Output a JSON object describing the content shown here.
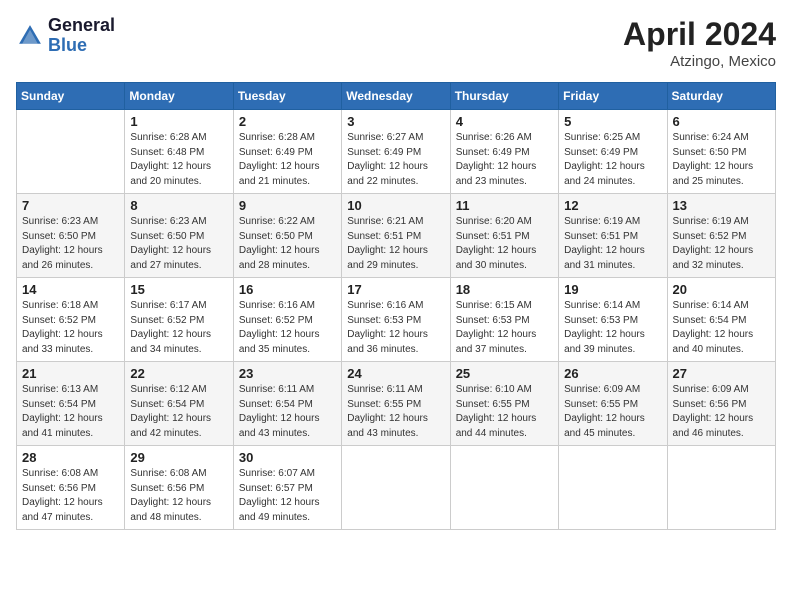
{
  "header": {
    "logo_line1": "General",
    "logo_line2": "Blue",
    "month": "April 2024",
    "location": "Atzingo, Mexico"
  },
  "weekdays": [
    "Sunday",
    "Monday",
    "Tuesday",
    "Wednesday",
    "Thursday",
    "Friday",
    "Saturday"
  ],
  "weeks": [
    [
      {
        "day": "",
        "info": ""
      },
      {
        "day": "1",
        "info": "Sunrise: 6:28 AM\nSunset: 6:48 PM\nDaylight: 12 hours\nand 20 minutes."
      },
      {
        "day": "2",
        "info": "Sunrise: 6:28 AM\nSunset: 6:49 PM\nDaylight: 12 hours\nand 21 minutes."
      },
      {
        "day": "3",
        "info": "Sunrise: 6:27 AM\nSunset: 6:49 PM\nDaylight: 12 hours\nand 22 minutes."
      },
      {
        "day": "4",
        "info": "Sunrise: 6:26 AM\nSunset: 6:49 PM\nDaylight: 12 hours\nand 23 minutes."
      },
      {
        "day": "5",
        "info": "Sunrise: 6:25 AM\nSunset: 6:49 PM\nDaylight: 12 hours\nand 24 minutes."
      },
      {
        "day": "6",
        "info": "Sunrise: 6:24 AM\nSunset: 6:50 PM\nDaylight: 12 hours\nand 25 minutes."
      }
    ],
    [
      {
        "day": "7",
        "info": "Sunrise: 6:23 AM\nSunset: 6:50 PM\nDaylight: 12 hours\nand 26 minutes."
      },
      {
        "day": "8",
        "info": "Sunrise: 6:23 AM\nSunset: 6:50 PM\nDaylight: 12 hours\nand 27 minutes."
      },
      {
        "day": "9",
        "info": "Sunrise: 6:22 AM\nSunset: 6:50 PM\nDaylight: 12 hours\nand 28 minutes."
      },
      {
        "day": "10",
        "info": "Sunrise: 6:21 AM\nSunset: 6:51 PM\nDaylight: 12 hours\nand 29 minutes."
      },
      {
        "day": "11",
        "info": "Sunrise: 6:20 AM\nSunset: 6:51 PM\nDaylight: 12 hours\nand 30 minutes."
      },
      {
        "day": "12",
        "info": "Sunrise: 6:19 AM\nSunset: 6:51 PM\nDaylight: 12 hours\nand 31 minutes."
      },
      {
        "day": "13",
        "info": "Sunrise: 6:19 AM\nSunset: 6:52 PM\nDaylight: 12 hours\nand 32 minutes."
      }
    ],
    [
      {
        "day": "14",
        "info": "Sunrise: 6:18 AM\nSunset: 6:52 PM\nDaylight: 12 hours\nand 33 minutes."
      },
      {
        "day": "15",
        "info": "Sunrise: 6:17 AM\nSunset: 6:52 PM\nDaylight: 12 hours\nand 34 minutes."
      },
      {
        "day": "16",
        "info": "Sunrise: 6:16 AM\nSunset: 6:52 PM\nDaylight: 12 hours\nand 35 minutes."
      },
      {
        "day": "17",
        "info": "Sunrise: 6:16 AM\nSunset: 6:53 PM\nDaylight: 12 hours\nand 36 minutes."
      },
      {
        "day": "18",
        "info": "Sunrise: 6:15 AM\nSunset: 6:53 PM\nDaylight: 12 hours\nand 37 minutes."
      },
      {
        "day": "19",
        "info": "Sunrise: 6:14 AM\nSunset: 6:53 PM\nDaylight: 12 hours\nand 39 minutes."
      },
      {
        "day": "20",
        "info": "Sunrise: 6:14 AM\nSunset: 6:54 PM\nDaylight: 12 hours\nand 40 minutes."
      }
    ],
    [
      {
        "day": "21",
        "info": "Sunrise: 6:13 AM\nSunset: 6:54 PM\nDaylight: 12 hours\nand 41 minutes."
      },
      {
        "day": "22",
        "info": "Sunrise: 6:12 AM\nSunset: 6:54 PM\nDaylight: 12 hours\nand 42 minutes."
      },
      {
        "day": "23",
        "info": "Sunrise: 6:11 AM\nSunset: 6:54 PM\nDaylight: 12 hours\nand 43 minutes."
      },
      {
        "day": "24",
        "info": "Sunrise: 6:11 AM\nSunset: 6:55 PM\nDaylight: 12 hours\nand 43 minutes."
      },
      {
        "day": "25",
        "info": "Sunrise: 6:10 AM\nSunset: 6:55 PM\nDaylight: 12 hours\nand 44 minutes."
      },
      {
        "day": "26",
        "info": "Sunrise: 6:09 AM\nSunset: 6:55 PM\nDaylight: 12 hours\nand 45 minutes."
      },
      {
        "day": "27",
        "info": "Sunrise: 6:09 AM\nSunset: 6:56 PM\nDaylight: 12 hours\nand 46 minutes."
      }
    ],
    [
      {
        "day": "28",
        "info": "Sunrise: 6:08 AM\nSunset: 6:56 PM\nDaylight: 12 hours\nand 47 minutes."
      },
      {
        "day": "29",
        "info": "Sunrise: 6:08 AM\nSunset: 6:56 PM\nDaylight: 12 hours\nand 48 minutes."
      },
      {
        "day": "30",
        "info": "Sunrise: 6:07 AM\nSunset: 6:57 PM\nDaylight: 12 hours\nand 49 minutes."
      },
      {
        "day": "",
        "info": ""
      },
      {
        "day": "",
        "info": ""
      },
      {
        "day": "",
        "info": ""
      },
      {
        "day": "",
        "info": ""
      }
    ]
  ]
}
